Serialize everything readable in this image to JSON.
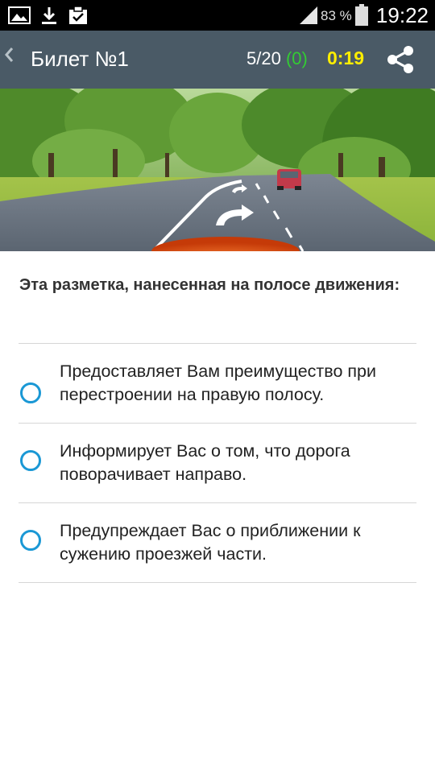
{
  "status_bar": {
    "battery_percent": "83 %",
    "time": "19:22",
    "icons": [
      "image-icon",
      "download-icon",
      "clipboard-icon",
      "signal-icon",
      "battery-icon"
    ]
  },
  "header": {
    "back_icon": "chevron-left-icon",
    "title": "Билет №1",
    "progress": "5/20",
    "correct_count": "(0)",
    "timer": "0:19",
    "share_icon": "share-icon"
  },
  "question": {
    "text": "Эта разметка, нанесенная на полосе движения:",
    "options": [
      {
        "label": "Предоставляет Вам преимущество при перестроении на правую полосу."
      },
      {
        "label": "Информирует Вас о том, что дорога поворачивает направо."
      },
      {
        "label": "Предупреждает Вас о приближении к сужению проезжей части."
      }
    ]
  },
  "colors": {
    "action_bar": "#4a5a66",
    "timer": "#ffee00",
    "correct": "#33cc33",
    "radio": "#1a98d5"
  }
}
